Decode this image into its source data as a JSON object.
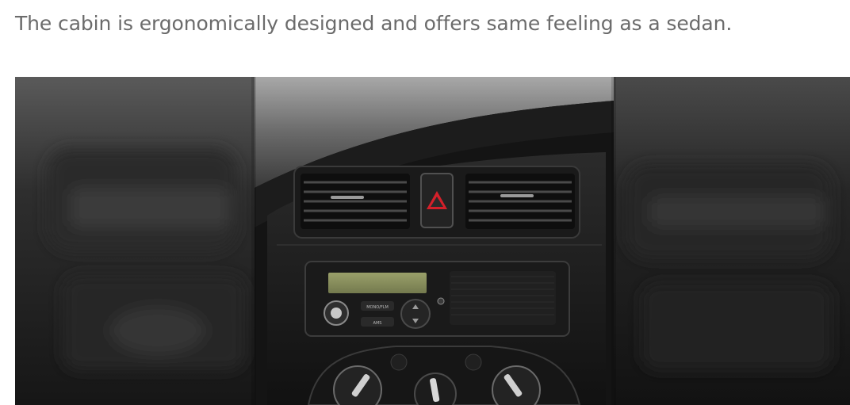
{
  "article": {
    "caption": "The cabin is ergonomically designed and offers same feeling as a sedan."
  },
  "photo": {
    "icon": "dashboard-photo",
    "subject": "car-center-console",
    "hazard_color": "#d4202a"
  },
  "radio": {
    "button_top": "MONO/FLM",
    "button_bottom": "AMS"
  }
}
